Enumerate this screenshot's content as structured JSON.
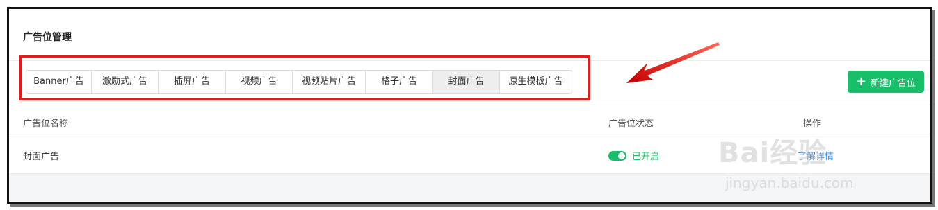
{
  "page": {
    "title": "广告位管理"
  },
  "tabs": [
    {
      "label": "Banner广告"
    },
    {
      "label": "激励式广告"
    },
    {
      "label": "插屏广告"
    },
    {
      "label": "视频广告"
    },
    {
      "label": "视频贴片广告"
    },
    {
      "label": "格子广告"
    },
    {
      "label": "封面广告",
      "active": true
    },
    {
      "label": "原生模板广告"
    }
  ],
  "toolbar": {
    "new_label": "新建广告位",
    "new_icon": "plus-icon"
  },
  "table": {
    "headers": {
      "name": "广告位名称",
      "status": "广告位状态",
      "actions": "操作"
    },
    "rows": [
      {
        "name": "封面广告",
        "status": "已开启",
        "action": "了解详情"
      }
    ]
  },
  "watermark": {
    "main": "Bai经验",
    "sub": "jingyan.baidu.com"
  },
  "colors": {
    "accent": "#19be6b",
    "link": "#2d8cf0",
    "highlight": "#e31b1b"
  }
}
